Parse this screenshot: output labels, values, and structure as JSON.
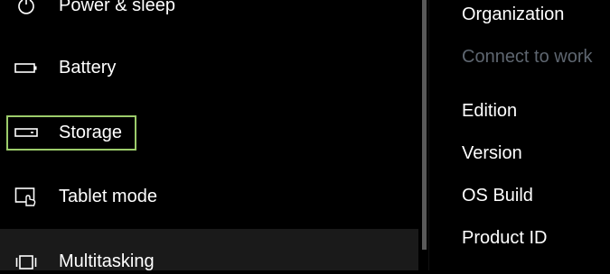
{
  "nav": {
    "items": [
      {
        "label": "Power & sleep",
        "icon": "power-icon"
      },
      {
        "label": "Battery",
        "icon": "battery-icon"
      },
      {
        "label": "Storage",
        "icon": "storage-icon"
      },
      {
        "label": "Tablet mode",
        "icon": "tablet-mode-icon"
      },
      {
        "label": "Multitasking",
        "icon": "multitasking-icon"
      }
    ],
    "focused_item": "Storage",
    "hover_item": "Multitasking"
  },
  "about": {
    "organization_label": "Organization",
    "connect_link": "Connect to work",
    "edition_label": "Edition",
    "version_label": "Version",
    "os_build_label": "OS Build",
    "product_id_label": "Product ID"
  },
  "colors": {
    "background": "#000000",
    "text": "#ffffff",
    "focus_border": "#9ccc6b",
    "disabled_text": "#5e6670",
    "hover_bg": "#1a1a1a"
  }
}
